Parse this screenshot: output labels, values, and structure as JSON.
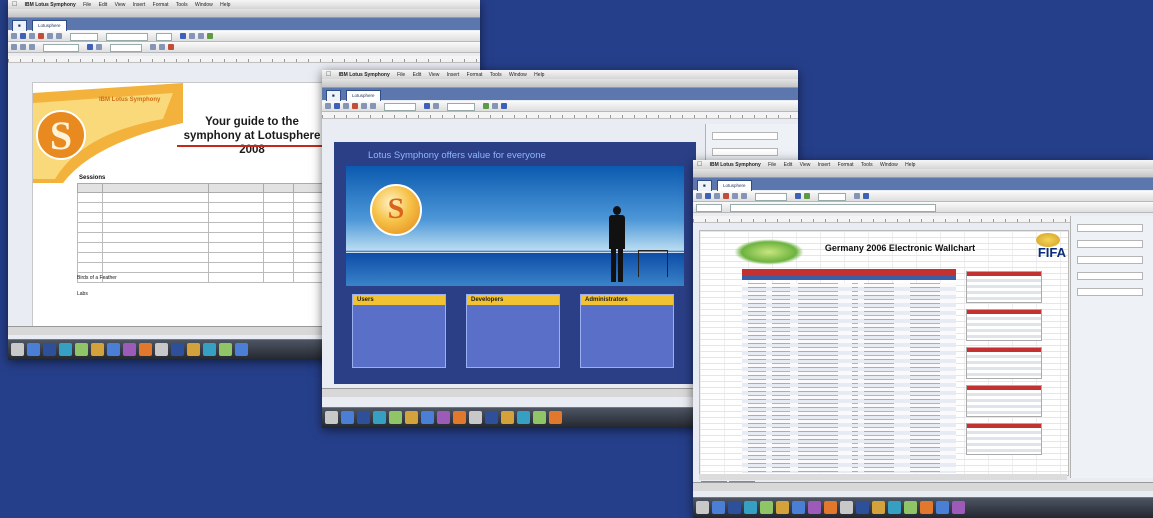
{
  "background_color": "#263f8a",
  "menubar": {
    "apple": "",
    "items": [
      "File",
      "Edit",
      "View",
      "Insert",
      "Format",
      "Tools",
      "Window",
      "Help"
    ]
  },
  "writer": {
    "app_name": "IBM Lotus Symphony",
    "title": "",
    "tab": "Lotusphere",
    "brand_line1": "IBM Lotus Symphony",
    "brand_line2": "",
    "doc_title": "Your guide to the symphony at Lotusphere 2008",
    "doc_intro": "",
    "agenda_title": "Sessions",
    "bullets_title": "Birds of a Feather",
    "bullets_sub": "",
    "bullets_footer": "Labs"
  },
  "impress": {
    "app_name": "IBM Lotus Symphony",
    "title": "",
    "tab": "Lotusphere",
    "slide_title": "Lotus Symphony offers value for everyone",
    "logo_letter": "S",
    "slide_text": "",
    "columns": [
      {
        "heading": "Users",
        "lines": []
      },
      {
        "heading": "Developers",
        "lines": []
      },
      {
        "heading": "Administrators",
        "lines": []
      }
    ]
  },
  "calc": {
    "app_name": "IBM Lotus Symphony",
    "title": "",
    "tab": "Lotusphere",
    "sheet_title": "Germany 2006 Electronic Wallchart",
    "fifa": "FIFA"
  }
}
